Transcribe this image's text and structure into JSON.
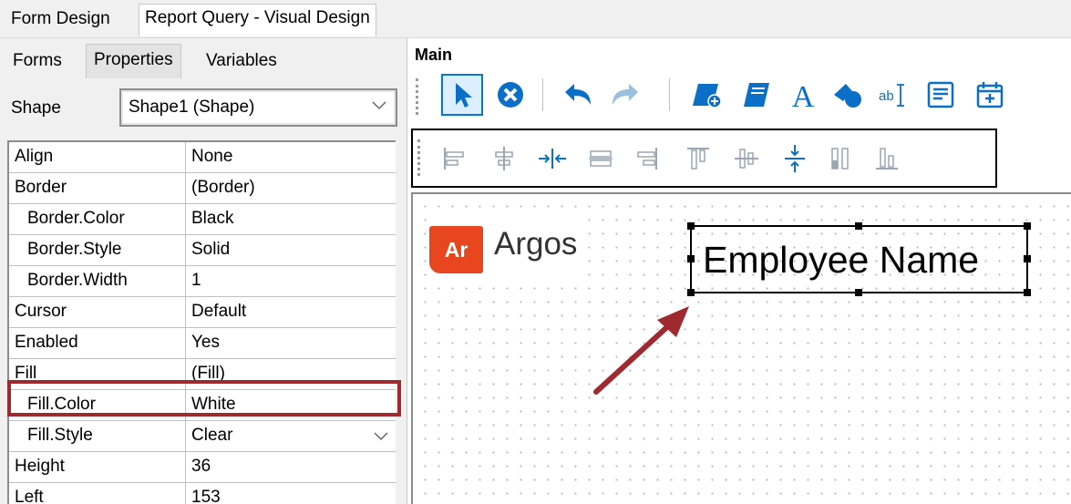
{
  "top_tabs": [
    "Form Design",
    "Report Query - Visual Design"
  ],
  "sub_tabs": [
    "Forms",
    "Properties",
    "Variables"
  ],
  "shape": {
    "label": "Shape",
    "value": "Shape1 (Shape)"
  },
  "properties": [
    {
      "name": "Align",
      "value": "None",
      "sub": false
    },
    {
      "name": "Border",
      "value": "(Border)",
      "sub": false
    },
    {
      "name": "Border.Color",
      "value": "Black",
      "sub": true
    },
    {
      "name": "Border.Style",
      "value": "Solid",
      "sub": true
    },
    {
      "name": "Border.Width",
      "value": "1",
      "sub": true
    },
    {
      "name": "Cursor",
      "value": "Default",
      "sub": false
    },
    {
      "name": "Enabled",
      "value": "Yes",
      "sub": false
    },
    {
      "name": "Fill",
      "value": "(Fill)",
      "sub": false
    },
    {
      "name": "Fill.Color",
      "value": "White",
      "sub": true
    },
    {
      "name": "Fill.Style",
      "value": "Clear",
      "sub": true
    },
    {
      "name": "Height",
      "value": "36",
      "sub": false
    },
    {
      "name": "Left",
      "value": "153",
      "sub": false
    }
  ],
  "main_label": "Main",
  "logo": {
    "badge": "Ar",
    "text": "Argos"
  },
  "canvas_label": "Employee Name",
  "colors": {
    "accent_blue": "#0b6fc7",
    "highlight_red": "#a0282f",
    "logo_orange": "#e8461f"
  },
  "toolbar1_icons": [
    "pointer-icon",
    "cancel-icon",
    "undo-icon",
    "redo-icon",
    "new-report-icon",
    "book-icon",
    "text-icon",
    "shape-icon",
    "textbox-icon",
    "memo-icon",
    "calendar-icon"
  ],
  "toolbar2_icons": [
    "align-left-icon",
    "align-center-icon",
    "center-horizontal-icon",
    "align-middle-icon",
    "align-right-icon",
    "align-top-icon",
    "align-middle-vertical-icon",
    "center-vertical-icon",
    "same-width-icon",
    "align-bottom-icon"
  ]
}
